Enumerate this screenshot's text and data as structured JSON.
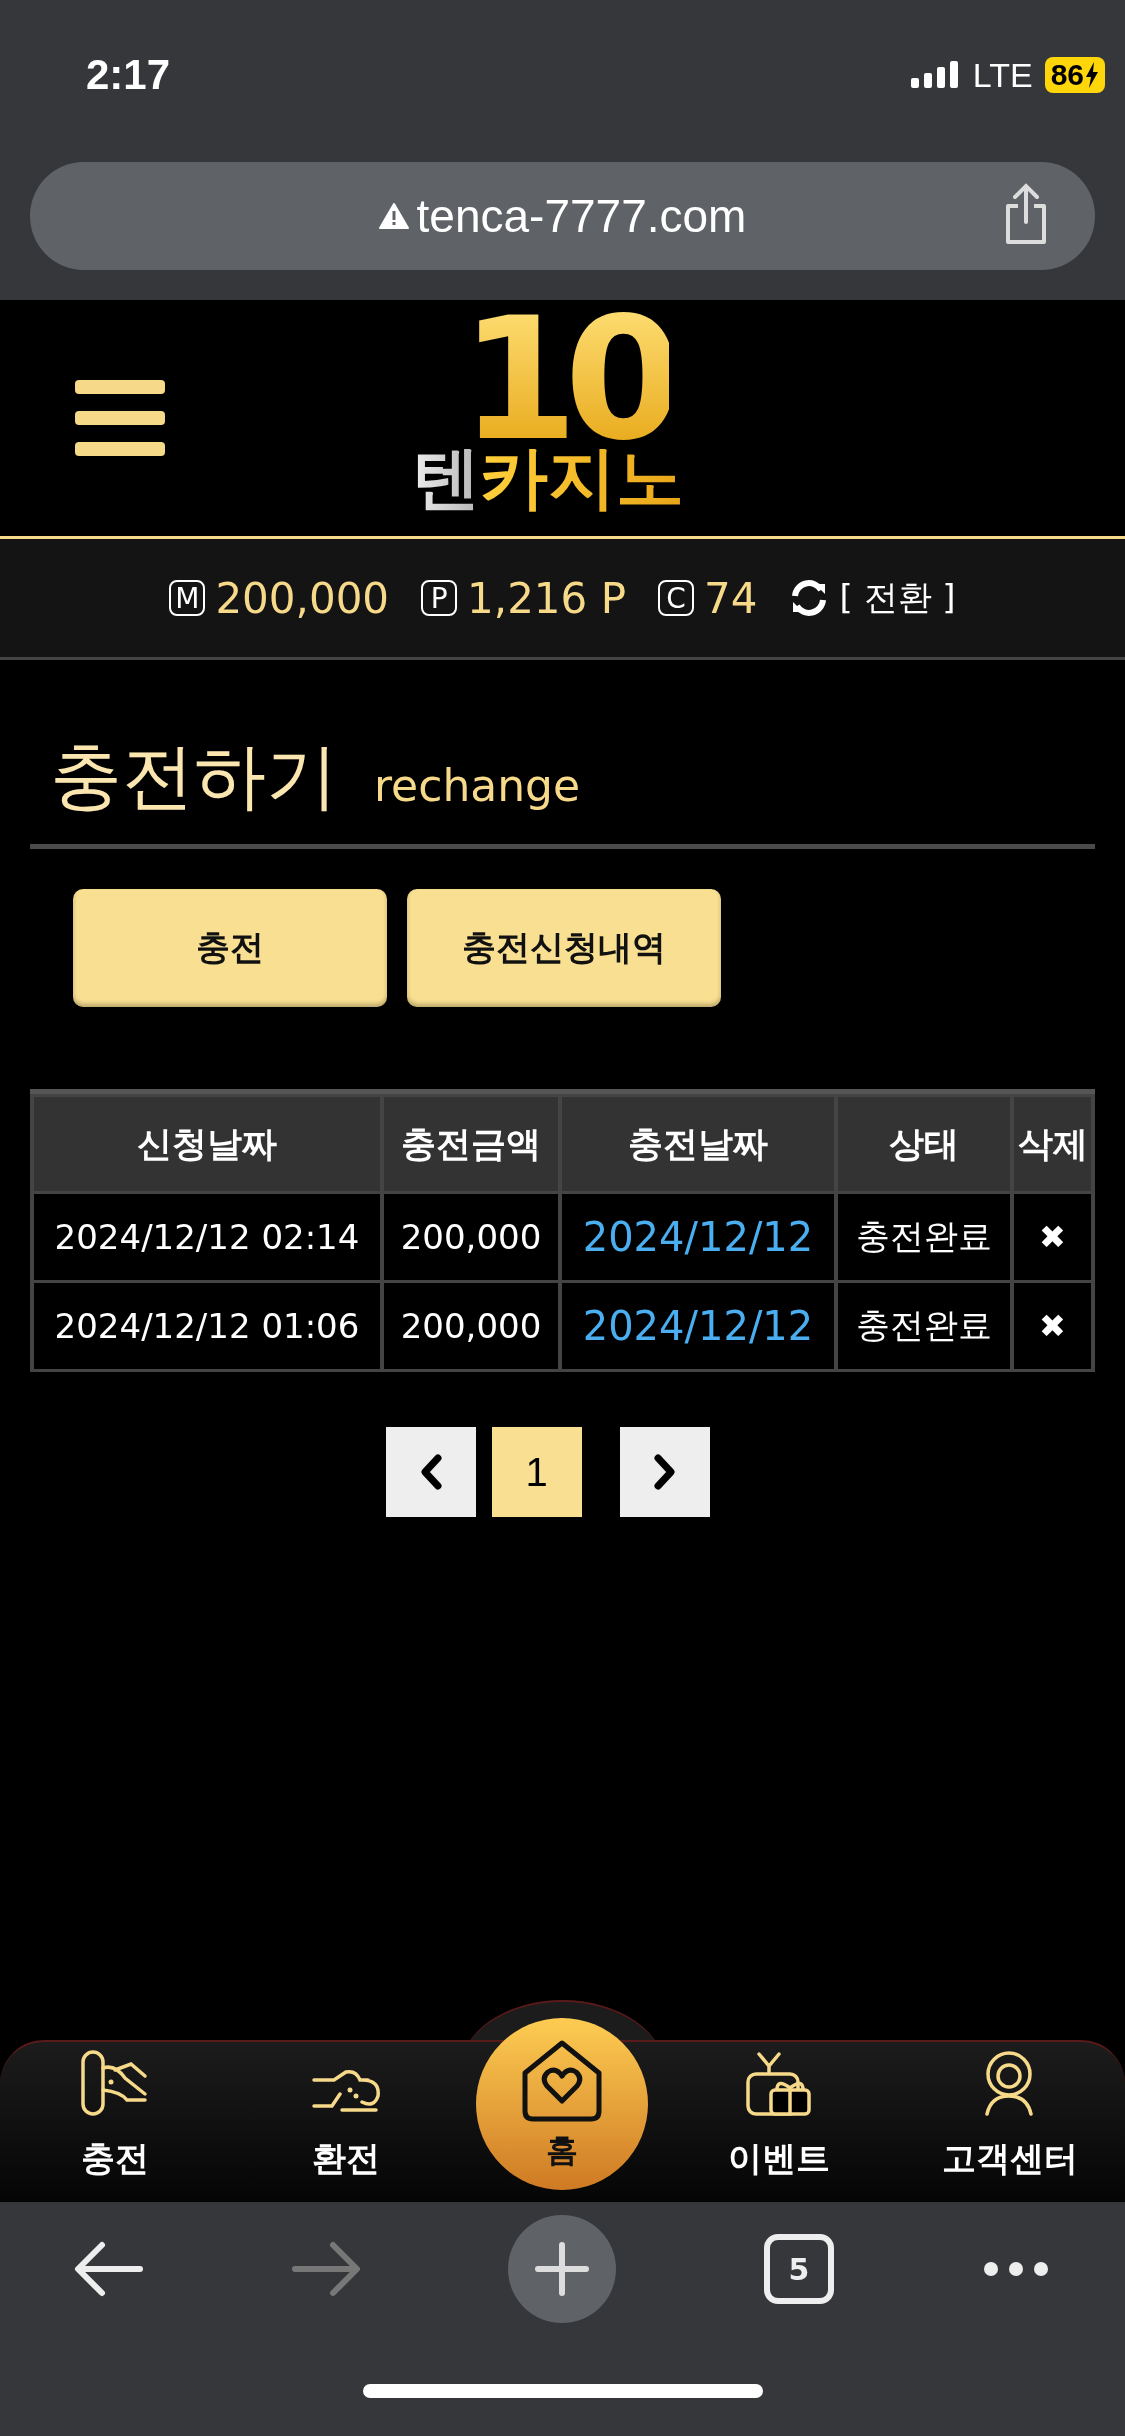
{
  "status_bar": {
    "time": "2:17",
    "network": "LTE",
    "battery": "86"
  },
  "address_bar": {
    "url": "tenca-7777.com"
  },
  "header": {
    "logo": {
      "number": "10",
      "name": "텐카지노"
    }
  },
  "balances": [
    {
      "symbol": "M",
      "value": "200,000"
    },
    {
      "symbol": "P",
      "value": "1,216 P"
    },
    {
      "symbol": "C",
      "value": "74"
    }
  ],
  "convert_label": "[ 전환 ]",
  "page_title": {
    "title": "충전하기",
    "subtitle": "rechange"
  },
  "buttons": [
    "충전",
    "충전신청내역"
  ],
  "table": {
    "columns": [
      "신청날짜",
      "충전금액",
      "충전날짜",
      "상태",
      "삭제"
    ],
    "rows": [
      {
        "request_date": "2024/12/12 02:14",
        "amount": "200,000",
        "charge_date": "2024/12/12",
        "status": "충전완료",
        "delete": "✖"
      },
      {
        "request_date": "2024/12/12 01:06",
        "amount": "200,000",
        "charge_date": "2024/12/12",
        "status": "충전완료",
        "delete": "✖"
      }
    ]
  },
  "pagination": {
    "pages": [
      {
        "label": "1",
        "selected": true
      }
    ]
  },
  "bottom_nav": [
    {
      "label": "충전",
      "kind": "charge"
    },
    {
      "label": "환전",
      "kind": "exchange"
    },
    {
      "label": "홈",
      "kind": "home"
    },
    {
      "label": "이벤트",
      "kind": "event"
    },
    {
      "label": "고객센터",
      "kind": "support"
    }
  ],
  "browser_toolbar": {
    "back_disabled": false,
    "forward_disabled": true,
    "tab_count": "5"
  }
}
